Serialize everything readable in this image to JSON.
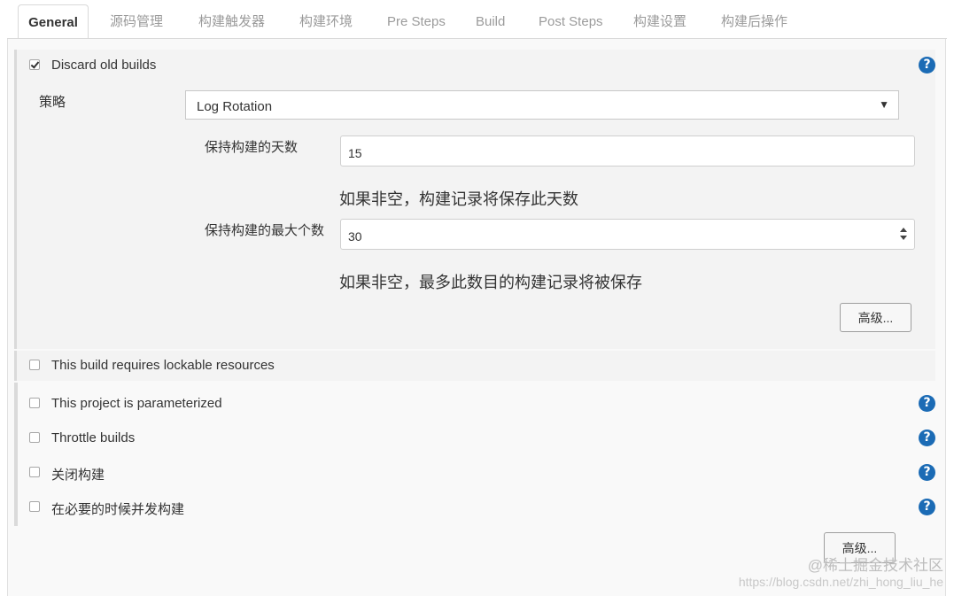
{
  "tabs": [
    {
      "label": "General"
    },
    {
      "label": "源码管理"
    },
    {
      "label": "构建触发器"
    },
    {
      "label": "构建环境"
    },
    {
      "label": "Pre Steps"
    },
    {
      "label": "Build"
    },
    {
      "label": "Post Steps"
    },
    {
      "label": "构建设置"
    },
    {
      "label": "构建后操作"
    }
  ],
  "discard": {
    "label": "Discard old builds",
    "checked": true,
    "strategy_label": "策略",
    "strategy_value": "Log Rotation",
    "days_label": "保持构建的天数",
    "days_value": "15",
    "days_hint": "如果非空，构建记录将保存此天数",
    "max_label": "保持构建的最大个数",
    "max_value": "30",
    "max_hint": "如果非空，最多此数目的构建记录将被保存",
    "advanced_label": "高级..."
  },
  "options": [
    {
      "label": "This build requires lockable resources",
      "checked": false
    },
    {
      "label": "This project is parameterized",
      "checked": false
    },
    {
      "label": "Throttle builds",
      "checked": false
    },
    {
      "label": "关闭构建",
      "checked": false
    },
    {
      "label": "在必要的时候并发构建",
      "checked": false
    }
  ],
  "help_glyph": "?",
  "bottom_advanced_label": "高级...",
  "watermark": {
    "line1": "@稀土掘金技术社区",
    "line2": "https://blog.csdn.net/zhi_hong_liu_he"
  }
}
